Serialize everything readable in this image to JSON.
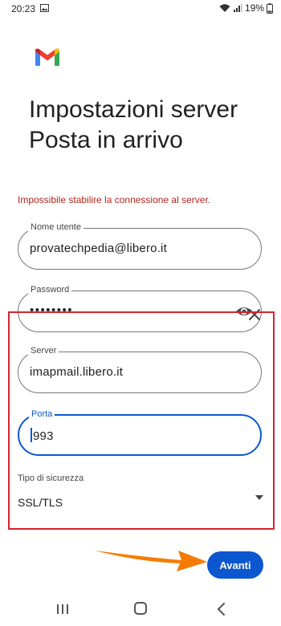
{
  "status_bar": {
    "time": "20:23",
    "battery": "19%"
  },
  "title": {
    "line1": "Impostazioni server",
    "line2": "Posta in arrivo"
  },
  "error_message": "Impossibile stabilire la connessione al server.",
  "fields": {
    "username": {
      "label": "Nome utente",
      "value": "provatechpedia@libero.it"
    },
    "password": {
      "label": "Password",
      "value": "••••••••"
    },
    "server": {
      "label": "Server",
      "value": "imapmail.libero.it"
    },
    "port": {
      "label": "Porta",
      "value": "993"
    }
  },
  "security": {
    "label": "Tipo di sicurezza",
    "value": "SSL/TLS"
  },
  "next_button": {
    "label": "Avanti"
  },
  "colors": {
    "accent": "#0b57d0",
    "error": "#b3261e",
    "annotation": "#d6232f",
    "arrow": "#f57c00"
  },
  "icons": [
    "gmail-logo",
    "eye-icon",
    "close-icon",
    "dropdown-arrow-icon",
    "recents-icon",
    "home-icon",
    "back-icon"
  ]
}
